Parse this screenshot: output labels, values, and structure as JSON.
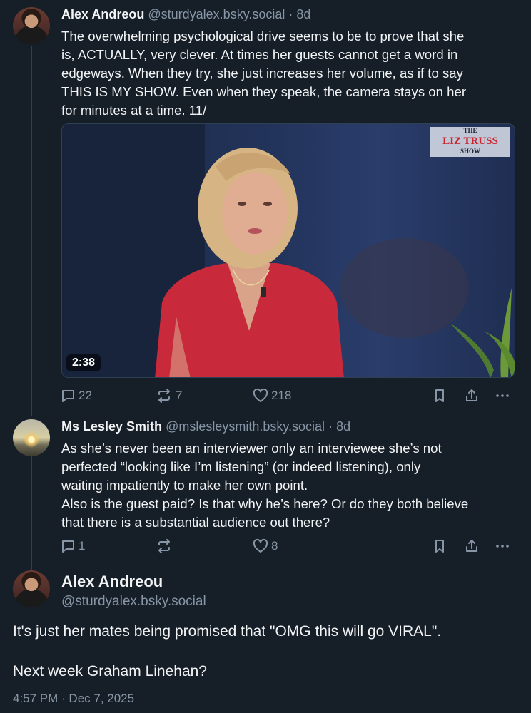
{
  "posts": [
    {
      "author": "Alex Andreou",
      "handle": "@sturdyalex.bsky.social",
      "age": "· 8d",
      "lines": [
        "The overwhelming psychological drive seems to be to prove that she",
        "is, ACTUALLY, very clever. At times her guests cannot get a word in",
        "edgeways. When they try, she just increases her volume, as if to say",
        "THIS IS MY SHOW. Even when they speak, the camera stays on her",
        "for minutes at a time. 11/"
      ],
      "video": {
        "duration": "2:38",
        "logo_line1": "THE",
        "logo_line2": "LIZ TRUSS",
        "logo_line3": "SHOW"
      },
      "replies": "22",
      "reposts": "7",
      "likes": "218"
    },
    {
      "author": "Ms Lesley Smith",
      "handle": "@mslesleysmith.bsky.social",
      "age": "· 8d",
      "lines": [
        "As she’s never been an interviewer only an interviewee she’s not",
        "perfected “looking like I’m listening” (or indeed listening), only",
        "waiting impatiently to make her own point.",
        "Also is the guest paid? Is that why he’s here? Or do they both believe",
        "that there is a substantial audience out there?"
      ],
      "replies": "1",
      "reposts": "",
      "likes": "8"
    }
  ],
  "focus": {
    "author": "Alex Andreou",
    "handle": "@sturdyalex.bsky.social",
    "line1": "It's just her mates being promised that \"OMG this will go VIRAL\".",
    "line2": "Next week Graham Linehan?",
    "timestamp": "4:57 PM · Dec 7, 2025"
  },
  "colors": {
    "background": "#161e27",
    "muted": "#8796a6",
    "thread_line": "#2e4052"
  }
}
